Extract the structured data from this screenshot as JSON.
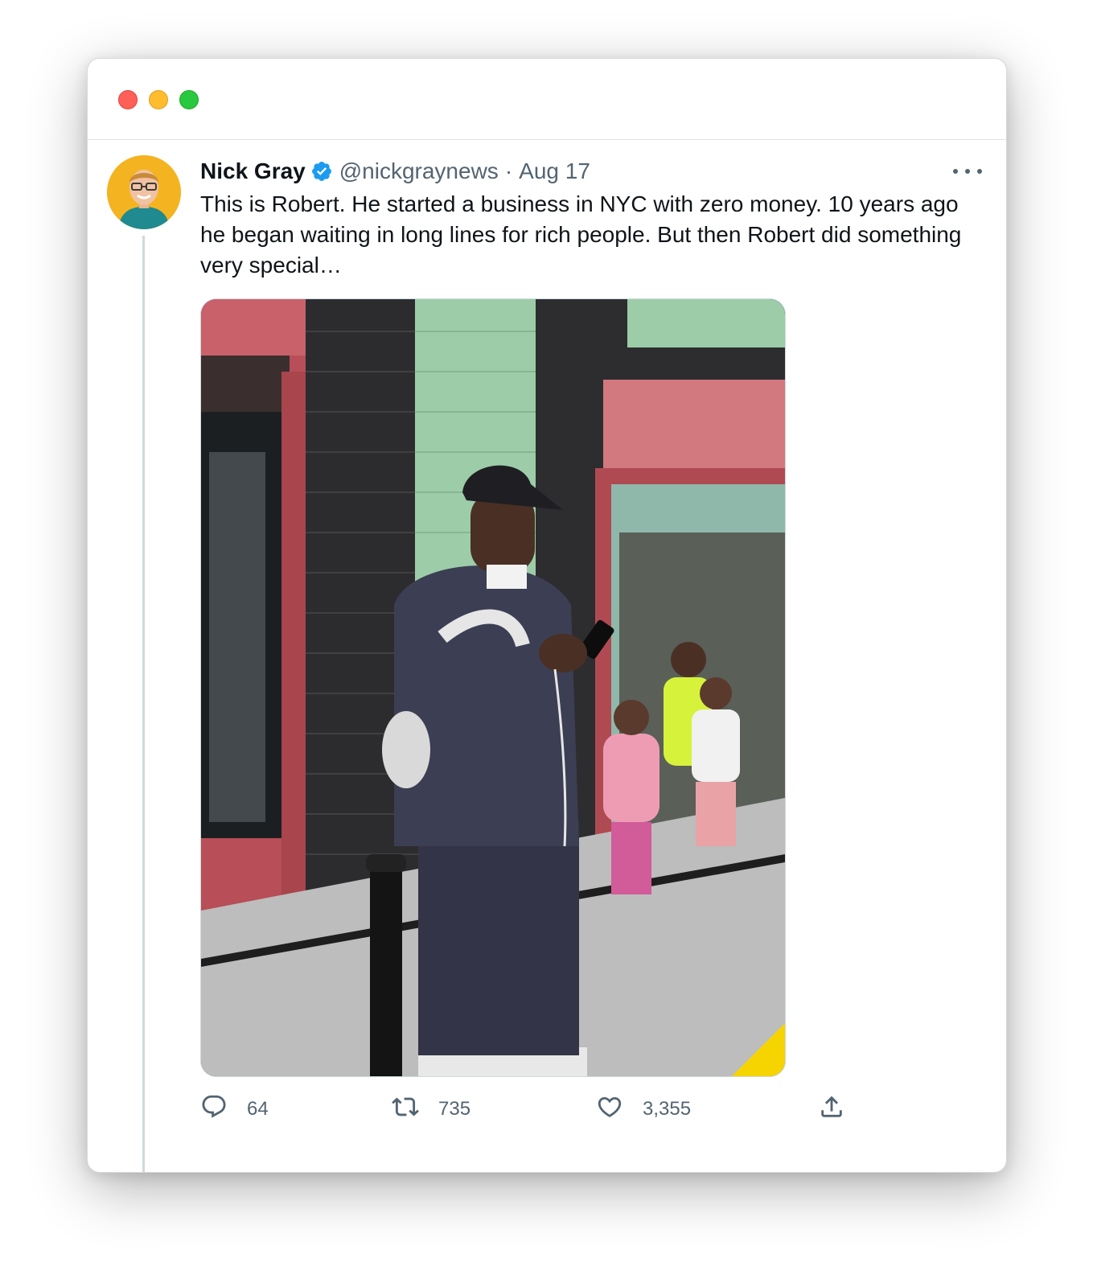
{
  "tweet": {
    "author_name": "Nick Gray",
    "handle": "@nickgraynews",
    "separator": "·",
    "date": "Aug 17",
    "text": "This is Robert. He started a business in NYC with zero money. 10 years ago he began waiting in long lines for rich people. But then Robert did something very special…",
    "verified": true
  },
  "actions": {
    "replies": "64",
    "retweets": "735",
    "likes": "3,355"
  },
  "icons": {
    "verified": "verified-badge-icon",
    "more": "more-options-icon",
    "reply": "reply-icon",
    "retweet": "retweet-icon",
    "like": "heart-icon",
    "share": "share-icon"
  },
  "colors": {
    "verified_blue": "#1d9bf0",
    "secondary_text": "#536471",
    "traffic_red": "#fe5f57",
    "traffic_yellow": "#febc2e",
    "traffic_green": "#28c840"
  }
}
